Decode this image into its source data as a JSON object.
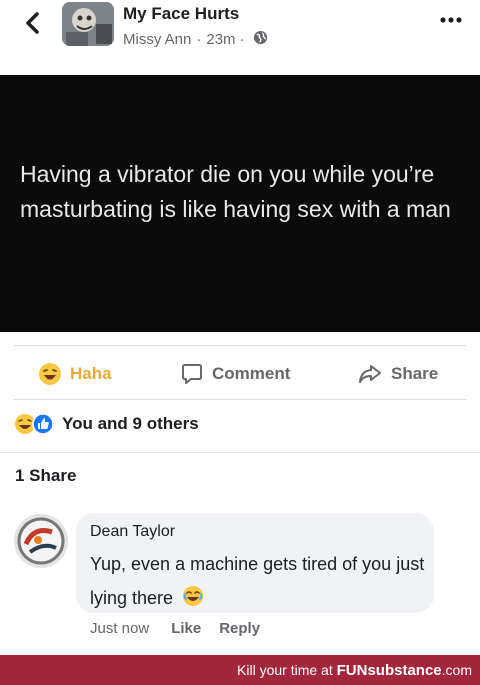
{
  "header": {
    "back_icon": "chevron-left-icon",
    "group_name": "My Face Hurts",
    "author": "Missy Ann",
    "time": "23m",
    "separator": "·",
    "privacy_icon": "globe-icon",
    "more_icon": "more-horizontal-icon"
  },
  "post": {
    "image_text": "Having a vibrator die on you while you’re masturbating is like having sex with a man",
    "image_bg": "#0b0b0b"
  },
  "actions": {
    "haha_label": "Haha",
    "comment_label": "Comment",
    "share_label": "Share",
    "haha_color": "#e8a93a"
  },
  "reactions": {
    "text": "You and 9 others",
    "icons": [
      "haha-reaction-icon",
      "like-reaction-icon"
    ]
  },
  "shares": {
    "text": "1 Share"
  },
  "comment": {
    "author": "Dean Taylor",
    "text": "Yup, even a machine gets tired of you just lying there",
    "emoji": "laughing-emoji-icon",
    "time": "Just now",
    "like_label": "Like",
    "reply_label": "Reply"
  },
  "watermark": {
    "prefix": "Kill your time at ",
    "brand": "FUNsubstance",
    "suffix": ".com",
    "bg": "#a3273a"
  }
}
